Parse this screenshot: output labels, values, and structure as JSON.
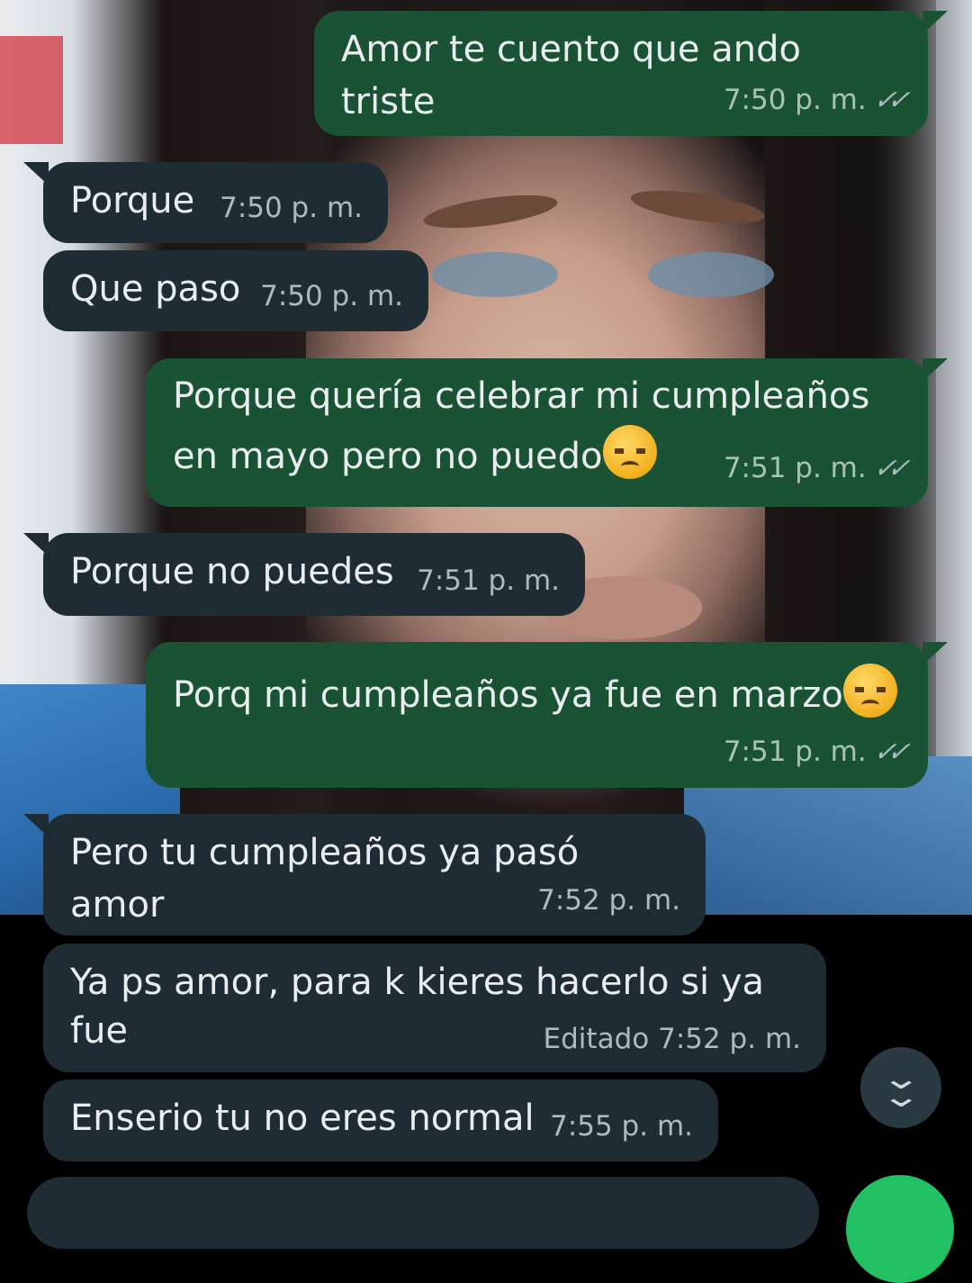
{
  "messages": [
    {
      "dir": "out",
      "text": "Amor te cuento que ando triste",
      "time": "7:50 p. m.",
      "read": true
    },
    {
      "dir": "in",
      "text": "Porque",
      "time": "7:50 p. m."
    },
    {
      "dir": "in",
      "text": "Que paso",
      "time": "7:50 p. m."
    },
    {
      "dir": "out",
      "text_line1": "Porque quería celebrar mi cumpleaños",
      "text_line2": "en mayo pero no puedo",
      "emoji": "disappointed-face-emoji",
      "time": "7:51 p. m.",
      "read": true
    },
    {
      "dir": "in",
      "text": "Porque no puedes",
      "time": "7:51 p. m."
    },
    {
      "dir": "out",
      "text": "Porq mi cumpleaños ya fue en marzo",
      "emoji": "disappointed-face-emoji",
      "time": "7:51 p. m.",
      "read": true
    },
    {
      "dir": "in",
      "text": "Pero tu cumpleaños ya pasó amor",
      "time": "7:52 p. m."
    },
    {
      "dir": "in",
      "text_line1": "Ya ps amor, para k kieres hacerlo si ya",
      "text_line2": "fue",
      "edited": "Editado",
      "time": "7:52 p. m."
    },
    {
      "dir": "in",
      "text": "Enserio tu no eres normal",
      "time": "7:55 p. m."
    }
  ],
  "icons": {
    "read_receipt": "double-check-icon",
    "scroll_down": "double-chevron-down-icon"
  },
  "colors": {
    "outgoing_bubble": "#1a5234",
    "incoming_bubble": "#202c33",
    "text": "#e9edef",
    "meta": "#aebac1",
    "fab": "#21c063"
  }
}
